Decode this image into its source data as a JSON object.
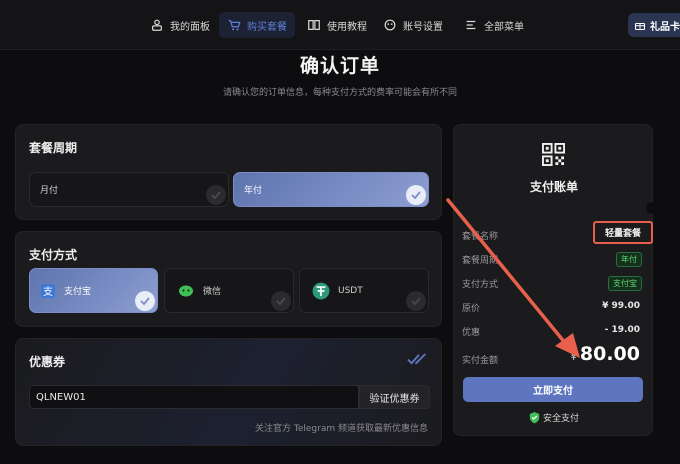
{
  "nav": {
    "items": [
      {
        "label": "我的面板",
        "icon": "dashboard-icon"
      },
      {
        "label": "购买套餐",
        "icon": "cart-icon",
        "active": true
      },
      {
        "label": "使用教程",
        "icon": "book-icon"
      },
      {
        "label": "账号设置",
        "icon": "user-settings-icon"
      },
      {
        "label": "全部菜单",
        "icon": "menu-icon"
      }
    ],
    "gift_label": "礼品卡"
  },
  "page": {
    "title": "确认订单",
    "subtitle": "请确认您的订单信息，每种支付方式的费率可能会有所不同"
  },
  "period": {
    "title": "套餐周期",
    "options": [
      {
        "label": "月付",
        "selected": false
      },
      {
        "label": "年付",
        "selected": true
      }
    ]
  },
  "payment": {
    "title": "支付方式",
    "options": [
      {
        "label": "支付宝",
        "icon": "alipay-icon",
        "selected": true
      },
      {
        "label": "微信",
        "icon": "wechat-icon",
        "selected": false
      },
      {
        "label": "USDT",
        "icon": "tether-icon",
        "selected": false
      }
    ]
  },
  "coupon": {
    "title": "优惠券",
    "value": "QLNEW01",
    "button": "验证优惠券",
    "note": "关注官方 Telegram 频道获取最新优惠信息"
  },
  "bill": {
    "title": "支付账单",
    "rows": {
      "plan_label": "套餐名称",
      "plan_value": "轻量套餐",
      "period_label": "套餐周期",
      "period_value": "年付",
      "method_label": "支付方式",
      "method_value": "支付宝",
      "price_label": "原价",
      "price_value": "¥ 99.00",
      "discount_label": "优惠",
      "discount_value": "- 19.00",
      "total_label": "实付金额",
      "currency": "¥",
      "total_value": "80.00"
    },
    "pay_button": "立即支付",
    "secure_label": "安全支付"
  },
  "colors": {
    "accent": "#5d76bf",
    "highlight_box": "#e8604c",
    "arrow": "#e8604c",
    "tag_green": "#5fd37a"
  }
}
